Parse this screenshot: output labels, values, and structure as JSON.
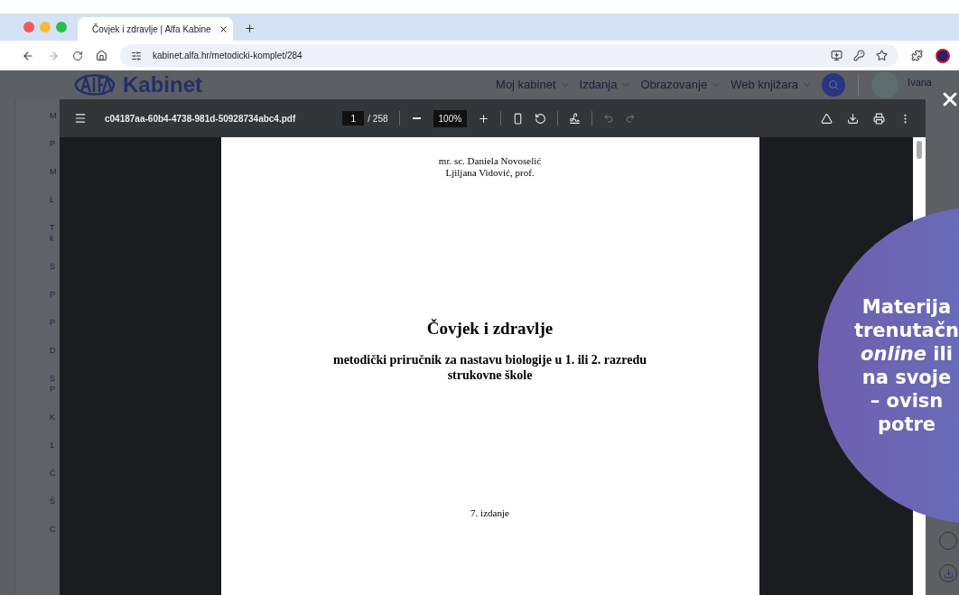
{
  "browser": {
    "tab": {
      "title": "Čovjek i zdravlje | Alfa Kabine",
      "selected": true
    },
    "url": "kabinet.alfa.hr/metodicki-komplet/284"
  },
  "site": {
    "logo": "Kabinet",
    "nav": [
      "Moj kabinet",
      "Izdanja",
      "Obrazovanje",
      "Web knjižara"
    ],
    "user": "Ivana",
    "sidebar_items": [
      {
        "lines": [
          "M"
        ]
      },
      {
        "lines": [
          "P"
        ]
      },
      {
        "lines": [
          "M"
        ]
      },
      {
        "lines": [
          "L"
        ]
      },
      {
        "lines": [
          "T",
          "k"
        ]
      },
      {
        "lines": [
          "S"
        ]
      },
      {
        "lines": [
          "P"
        ]
      },
      {
        "lines": [
          "P"
        ]
      },
      {
        "lines": [
          "D"
        ]
      },
      {
        "lines": [
          "S",
          "P"
        ]
      },
      {
        "lines": [
          "K"
        ]
      },
      {
        "lines": [
          "1"
        ]
      },
      {
        "lines": [
          "Č"
        ]
      },
      {
        "lines": [
          "Š"
        ]
      },
      {
        "lines": [
          "C"
        ]
      }
    ]
  },
  "pdf_viewer": {
    "file_name": "c04187aa-60b4-4738-981d-50928734abc4.pdf",
    "page": "1",
    "page_count": "/ 258",
    "zoom": "100%",
    "page_content": {
      "authors": [
        "mr. sc. Daniela Novoselić",
        "Ljiljana Vidović, prof."
      ],
      "title": "Čovjek i zdravlje",
      "subtitle": "metodički priručnik za nastavu biologije u 1. ili 2. razredu strukovne škole",
      "edition": "7. izdanje"
    }
  },
  "promo_bubble": {
    "lines": [
      "Materija",
      "trenutačn",
      "*online* ili",
      "na svoje",
      "– ovisn",
      "potre"
    ]
  }
}
